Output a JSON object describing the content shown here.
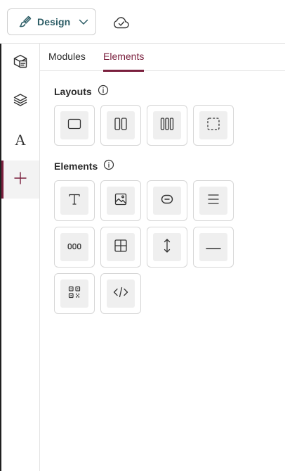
{
  "toolbar": {
    "mode_label": "Design",
    "mode_icon": "brush-icon",
    "cloud_icon": "cloud-check-icon"
  },
  "rail": {
    "items": [
      {
        "icon": "templates-icon"
      },
      {
        "icon": "layers-icon"
      },
      {
        "icon": "typography-icon",
        "glyph": "A"
      },
      {
        "icon": "plus-icon",
        "active": true
      }
    ]
  },
  "tabs": [
    {
      "label": "Modules",
      "active": false
    },
    {
      "label": "Elements",
      "active": true
    }
  ],
  "sections": {
    "layouts": {
      "title": "Layouts",
      "items": [
        "one-column-layout-icon",
        "two-column-layout-icon",
        "three-column-layout-icon",
        "empty-layout-icon"
      ]
    },
    "elements": {
      "title": "Elements",
      "items": [
        "text-icon",
        "image-icon",
        "button-icon",
        "paragraph-icon",
        "social-icon",
        "table-icon",
        "spacer-icon",
        "divider-icon",
        "qr-code-icon",
        "code-icon"
      ]
    }
  },
  "colors": {
    "accent": "#7a1f3d",
    "brand_text": "#2d5d66",
    "tile_bg": "#efefef",
    "border": "#d6d6d6"
  }
}
